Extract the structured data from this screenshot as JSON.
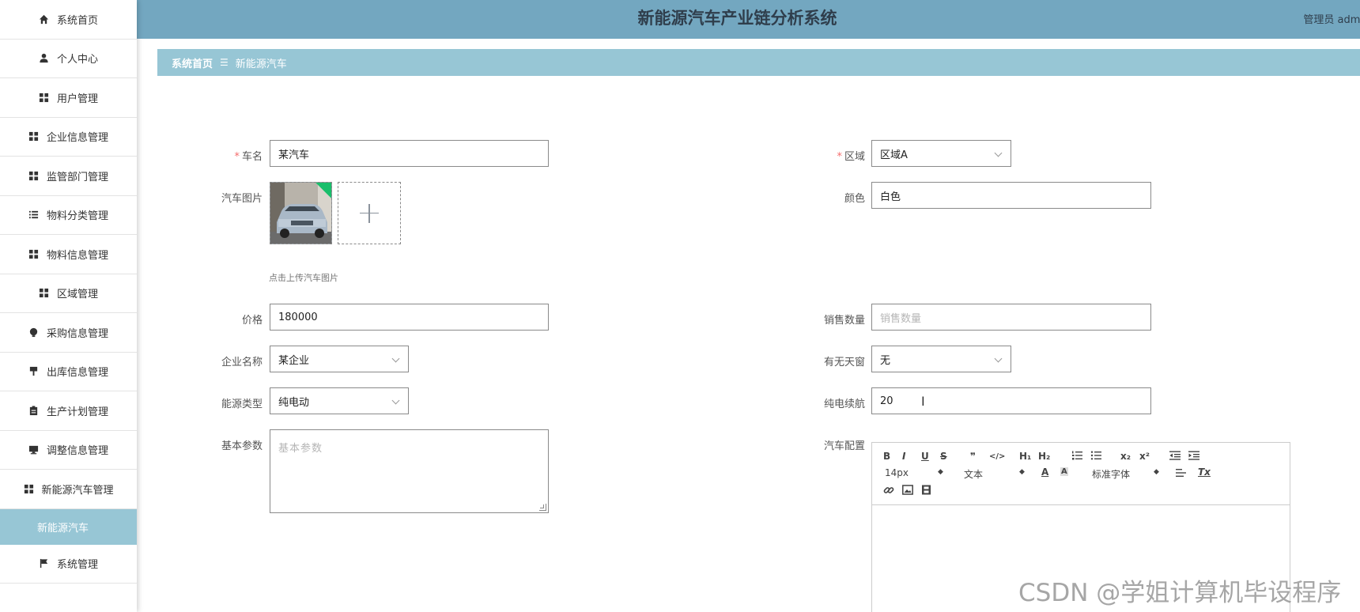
{
  "header": {
    "title": "新能源汽车产业链分析系统",
    "user": "管理员 admi"
  },
  "sidebar": {
    "items": [
      {
        "label": "系统首页",
        "icon": "home-icon"
      },
      {
        "label": "个人中心",
        "icon": "user-icon"
      },
      {
        "label": "用户管理",
        "icon": "grid-icon"
      },
      {
        "label": "企业信息管理",
        "icon": "grid-icon"
      },
      {
        "label": "监管部门管理",
        "icon": "grid-icon"
      },
      {
        "label": "物料分类管理",
        "icon": "list-icon"
      },
      {
        "label": "物料信息管理",
        "icon": "grid-icon"
      },
      {
        "label": "区域管理",
        "icon": "grid-icon"
      },
      {
        "label": "采购信息管理",
        "icon": "bulb-icon"
      },
      {
        "label": "出库信息管理",
        "icon": "pin-icon"
      },
      {
        "label": "生产计划管理",
        "icon": "clipboard-icon"
      },
      {
        "label": "调整信息管理",
        "icon": "monitor-icon"
      },
      {
        "label": "新能源汽车管理",
        "icon": "grid-icon"
      },
      {
        "label": "系统管理",
        "icon": "flag-icon"
      }
    ],
    "active_sub": "新能源汽车"
  },
  "breadcrumb": {
    "home": "系统首页",
    "separator": "☰",
    "current": "新能源汽车"
  },
  "form": {
    "car_name": {
      "label": "车名",
      "value": "某汽车",
      "required": true
    },
    "region": {
      "label": "区域",
      "value": "区域A",
      "required": true
    },
    "car_image": {
      "label": "汽车图片",
      "hint": "点击上传汽车图片"
    },
    "color": {
      "label": "颜色",
      "value": "白色"
    },
    "price": {
      "label": "价格",
      "value": "180000"
    },
    "sales_qty": {
      "label": "销售数量",
      "placeholder": "销售数量"
    },
    "company": {
      "label": "企业名称",
      "value": "某企业"
    },
    "sunroof": {
      "label": "有无天窗",
      "value": "无"
    },
    "energy_type": {
      "label": "能源类型",
      "value": "纯电动"
    },
    "range": {
      "label": "纯电续航",
      "value": "20"
    },
    "basic_params": {
      "label": "基本参数",
      "placeholder": "基本参数"
    },
    "config": {
      "label": "汽车配置"
    }
  },
  "editor": {
    "font_size": "14px",
    "text_style": "文本",
    "font_family": "标准字体",
    "bold": "B",
    "italic": "I",
    "underline": "U",
    "strike": "S",
    "quote": "❞",
    "code": "</>",
    "h1": "H₁",
    "h2": "H₂",
    "sub": "x₂",
    "sup": "x²",
    "font_color": "A",
    "bg_color": "A",
    "clear": "Tx"
  },
  "watermark": "CSDN @学姐计算机毕设程序",
  "colors": {
    "header": "#73a7c0",
    "accent": "#97c6d5",
    "required": "#f56c6c",
    "corner": "#19be6b"
  }
}
